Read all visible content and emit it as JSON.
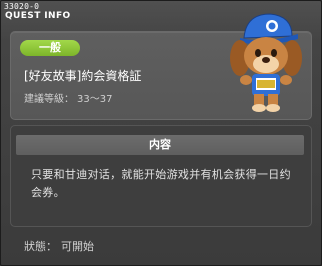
{
  "window": {
    "quest_id": "33020-0",
    "title": "QUEST INFO"
  },
  "quest": {
    "category": "一般",
    "title": "[好友故事]約会資格証",
    "level_label": "建議等級：",
    "level_value": "33～37"
  },
  "content": {
    "header": "内容",
    "text": "只要和甘迪对话，就能开始游戏并有机会获得一日约会券。"
  },
  "status": {
    "label": "狀態：",
    "value": "可開始"
  },
  "colors": {
    "badge": "#8cc63f",
    "panel": "#5a5a5a"
  },
  "icons": {
    "npc": "dog-npc-with-blue-cap"
  }
}
